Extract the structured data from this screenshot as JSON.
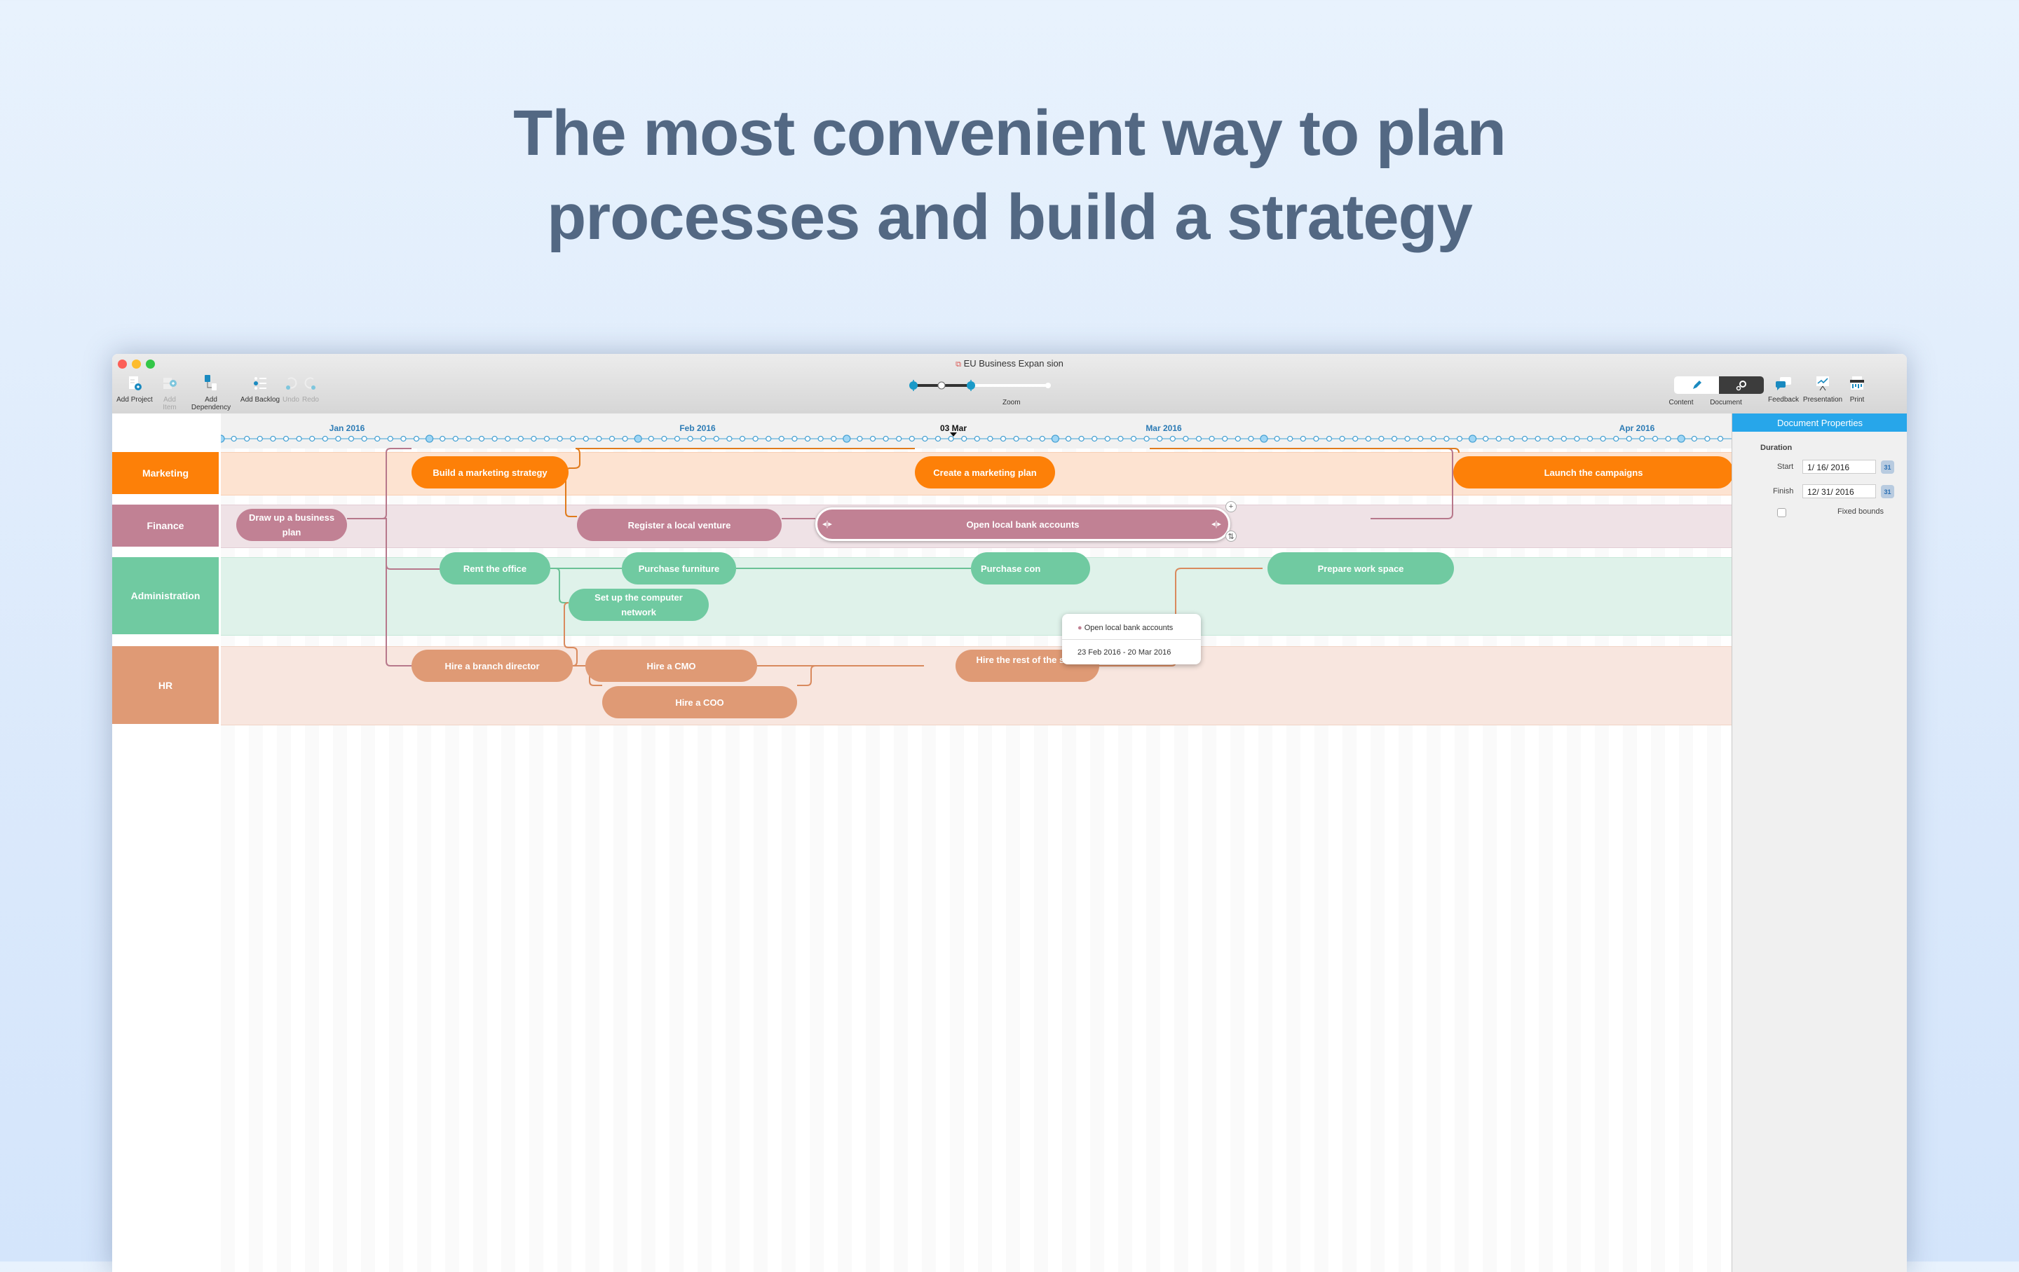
{
  "headline": {
    "line1": "The most convenient way to plan",
    "line2": "processes and build a strategy"
  },
  "window": {
    "title": "EU Business Expan sion",
    "controls": {
      "close_color": "#fc5f57",
      "minimize_color": "#fdbc2e",
      "zoom_color": "#33c748"
    }
  },
  "toolbar": {
    "left": [
      {
        "label": "Add Project",
        "icon": "add-project-icon",
        "enabled": true
      },
      {
        "label": "Add Item",
        "icon": "add-item-icon",
        "enabled": false
      },
      {
        "label": "Add Dependency",
        "icon": "add-dependency-icon",
        "enabled": true
      },
      {
        "label": "Add Backlog",
        "icon": "add-backlog-icon",
        "enabled": true
      },
      {
        "label": "Undo",
        "icon": "undo-icon",
        "enabled": false
      },
      {
        "label": "Redo",
        "icon": "redo-icon",
        "enabled": false
      }
    ],
    "zoom": {
      "label": "Zoom",
      "range_start": 0.0,
      "range_end": 0.29
    },
    "right": [
      {
        "label": "Content",
        "icon": "pencil-icon",
        "selected": false
      },
      {
        "label": "Document",
        "icon": "gears-icon",
        "selected": true
      },
      {
        "label": "Feedback",
        "icon": "feedback-icon"
      },
      {
        "label": "Presentation",
        "icon": "presentation-icon"
      },
      {
        "label": "Print",
        "icon": "print-icon"
      }
    ]
  },
  "timeline": {
    "months": [
      "Jan 2016",
      "Feb 2016",
      "Mar 2016",
      "Apr 2016"
    ],
    "current_marker": "03 Mar"
  },
  "lanes": [
    {
      "name": "Marketing",
      "color": "#fd8008",
      "band": "#fde3d1"
    },
    {
      "name": "Finance",
      "color": "#c18194",
      "band": "#efe2e6"
    },
    {
      "name": "Administration",
      "color": "#70caa1",
      "band": "#dff2ea"
    },
    {
      "name": "HR",
      "color": "#df9a75",
      "band": "#f8e6df"
    }
  ],
  "tasks": [
    {
      "lane": "Marketing",
      "name": "Build a marketing strategy"
    },
    {
      "lane": "Marketing",
      "name": "Create a marketing plan"
    },
    {
      "lane": "Marketing",
      "name": "Launch the campaigns"
    },
    {
      "lane": "Finance",
      "name": "Draw up a business plan"
    },
    {
      "lane": "Finance",
      "name": "Register a local venture"
    },
    {
      "lane": "Finance",
      "name": "Open local bank accounts",
      "selected": true
    },
    {
      "lane": "Administration",
      "name": "Rent the office"
    },
    {
      "lane": "Administration",
      "name": "Purchase furniture"
    },
    {
      "lane": "Administration",
      "name": "Set up the computer network"
    },
    {
      "lane": "Administration",
      "name": "Purchase con"
    },
    {
      "lane": "Administration",
      "name": "Prepare work space"
    },
    {
      "lane": "HR",
      "name": "Hire a branch director"
    },
    {
      "lane": "HR",
      "name": "Hire a CMO"
    },
    {
      "lane": "HR",
      "name": "Hire a COO"
    },
    {
      "lane": "HR",
      "name": "Hire the rest of the staff"
    }
  ],
  "popover": {
    "title": "Open local bank accounts",
    "dates": "23 Feb 2016 - 20 Mar 2016"
  },
  "right_panel": {
    "header": "Document Properties",
    "section": "Duration",
    "start_label": "Start",
    "start_value": "1/ 16/ 2016",
    "finish_label": "Finish",
    "finish_value": "12/ 31/ 2016",
    "fixed_bounds_label": "Fixed bounds",
    "fixed_bounds_checked": false,
    "calendar_glyph": "31"
  }
}
